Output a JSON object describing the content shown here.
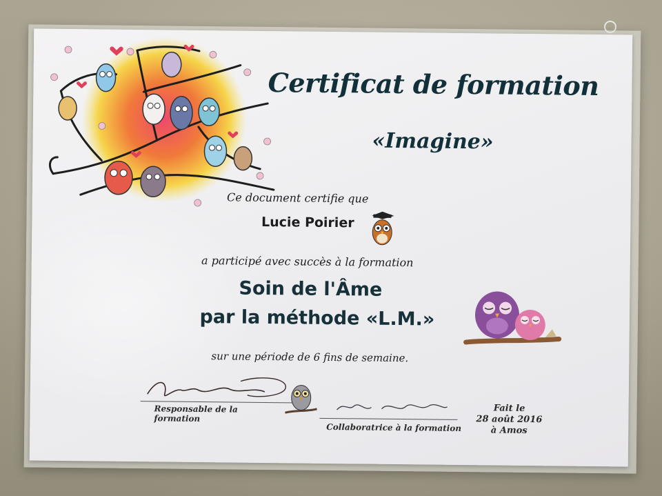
{
  "certificate": {
    "title": "Certificat de formation",
    "subtitle": "«Imagine»",
    "certify_line": "Ce document certifie que",
    "recipient_name": "Lucie Poirier",
    "participation_line": "a participé avec succès à la formation",
    "course_line1": "Soin de l'Âme",
    "course_line2": "par la méthode «L.M.»",
    "period_line": "sur une période de 6 fins de semaine.",
    "signature_left_label": "Responsable de la formation",
    "signature_right_label": "Collaboratrice à la formation",
    "date_line1": "Fait le",
    "date_line2": "28 août 2016",
    "date_line3": "à Amos"
  },
  "colors": {
    "title_ink": "#12303a",
    "owl_purple": "#8a4f9a",
    "owl_pink": "#e07aa8",
    "tree_sun": "#f2a33a"
  },
  "icons": {
    "tree_owls_art": "tree-with-owls-illustration",
    "graduate_owl": "graduate-owl-icon",
    "owl_pair": "owl-pair-on-branch-icon",
    "small_owl": "small-owl-icon"
  }
}
